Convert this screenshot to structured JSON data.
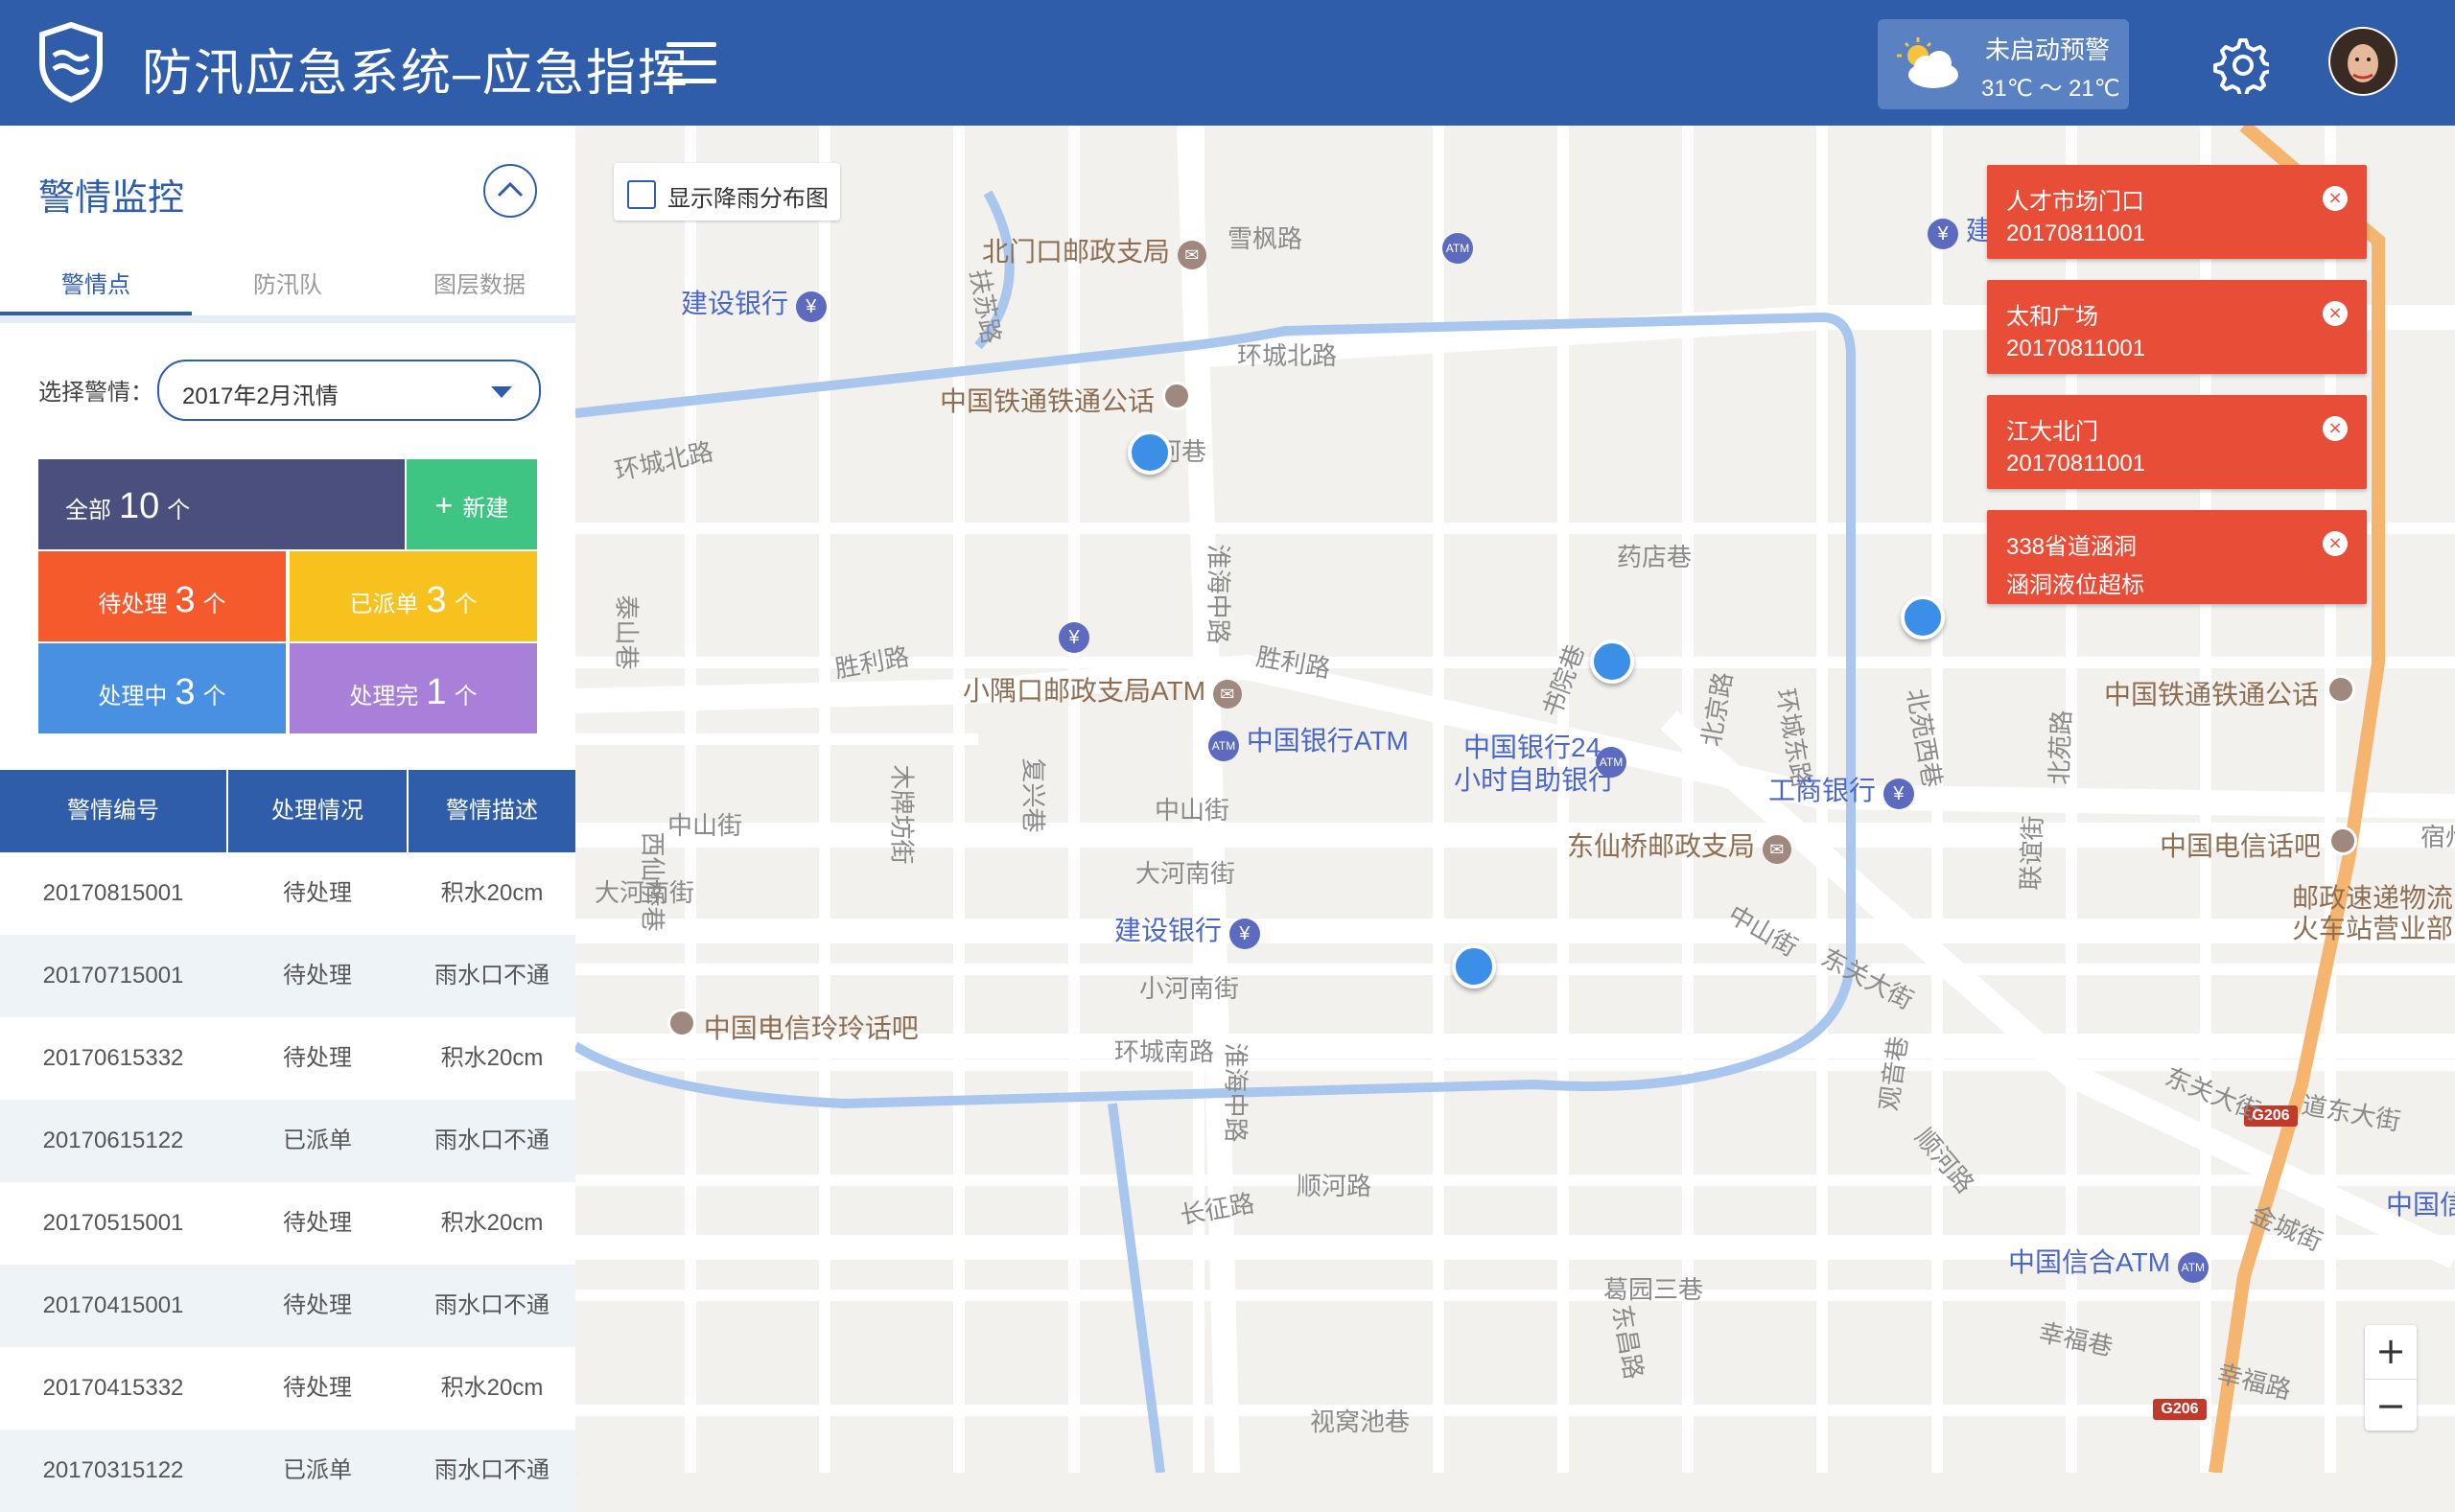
{
  "header": {
    "title": "防汛应急系统–应急指挥",
    "weather_status": "未启动预警",
    "weather_temp": "31℃ ～ 21℃"
  },
  "sidebar": {
    "title": "警情监控",
    "tabs": [
      "警情点",
      "防汛队",
      "图层数据"
    ],
    "active_tab": 0,
    "select_label": "选择警情：",
    "select_value": "2017年2月汛情",
    "stats": {
      "all": {
        "label": "全部",
        "count": "10",
        "unit": "个",
        "color": "#4a4f7e"
      },
      "new": {
        "label": "新建",
        "icon": "+",
        "color": "#3ec583"
      },
      "pending": {
        "label": "待处理",
        "count": "3",
        "unit": "个",
        "color": "#f45a2c"
      },
      "dispatched": {
        "label": "已派单",
        "count": "3",
        "unit": "个",
        "color": "#f7c21e"
      },
      "processing": {
        "label": "处理中",
        "count": "3",
        "unit": "个",
        "color": "#4a90e2"
      },
      "done": {
        "label": "处理完",
        "count": "1",
        "unit": "个",
        "color": "#a87fd9"
      }
    },
    "table": {
      "headers": [
        "警情编号",
        "处理情况",
        "警情描述"
      ],
      "rows": [
        [
          "20170815001",
          "待处理",
          "积水20cm"
        ],
        [
          "20170715001",
          "待处理",
          "雨水口不通"
        ],
        [
          "20170615332",
          "待处理",
          "积水20cm"
        ],
        [
          "20170615122",
          "已派单",
          "雨水口不通"
        ],
        [
          "20170515001",
          "待处理",
          "积水20cm"
        ],
        [
          "20170415001",
          "待处理",
          "雨水口不通"
        ],
        [
          "20170415332",
          "待处理",
          "积水20cm"
        ],
        [
          "20170315122",
          "已派单",
          "雨水口不通"
        ]
      ]
    }
  },
  "map": {
    "rain_toggle_label": "显示降雨分布图",
    "alerts": [
      {
        "title": "人才市场门口",
        "detail": "20170811001"
      },
      {
        "title": "太和广场",
        "detail": "20170811001"
      },
      {
        "title": "江大北门",
        "detail": "20170811001"
      },
      {
        "title": "338省道涵洞",
        "detail": "涵洞液位超标"
      }
    ],
    "road_labels": [
      "雪枫路",
      "环城北路",
      "环城北路",
      "龙河巷",
      "扶苏路",
      "胜利路",
      "胜利路",
      "淮海中路",
      "淮海中路",
      "中山街",
      "中山街",
      "大河南街",
      "大河南街",
      "小河南街",
      "环城南路",
      "长征路",
      "顺河路",
      "药店巷",
      "中山街",
      "东关大街",
      "东关大街",
      "道东大街",
      "金城街",
      "幸福巷",
      "幸福路",
      "葛园三巷",
      "视窝池巷",
      "泰山巷",
      "西仙桥巷",
      "木牌坊街",
      "复兴巷",
      "书院巷",
      "北京路",
      "环城东路",
      "北苑西巷",
      "北苑路",
      "联谊街",
      "观音巷",
      "顺河路",
      "东昌路",
      "宿州"
    ],
    "pois": [
      {
        "name": "北门口邮政支局",
        "kind": "post"
      },
      {
        "name": "建设银行",
        "kind": "bank"
      },
      {
        "name": "建设银行",
        "kind": "bank"
      },
      {
        "name": "中国铁通铁通公话",
        "kind": "phone"
      },
      {
        "name": "小隅口邮政支局ATM",
        "kind": "post"
      },
      {
        "name": "中国银行ATM",
        "kind": "atm"
      },
      {
        "name": "中国银行24",
        "kind": "atm"
      },
      {
        "name": "小时自助银行",
        "kind": "atm"
      },
      {
        "name": "工商银行",
        "kind": "bank"
      },
      {
        "name": "东仙桥邮政支局",
        "kind": "post"
      },
      {
        "name": "建设银行",
        "kind": "bank"
      },
      {
        "name": "中国电信玲玲话吧",
        "kind": "phone"
      },
      {
        "name": "中国铁通铁通公话",
        "kind": "phone"
      },
      {
        "name": "中国电信话吧",
        "kind": "phone"
      },
      {
        "name": "邮政速递物流",
        "kind": "text"
      },
      {
        "name": "火车站营业部",
        "kind": "text"
      },
      {
        "name": "中国信合ATM",
        "kind": "atm"
      },
      {
        "name": "中国信",
        "kind": "text"
      }
    ],
    "highway_labels": [
      "G206",
      "G206"
    ],
    "zoom_in": "+",
    "zoom_out": "−"
  }
}
